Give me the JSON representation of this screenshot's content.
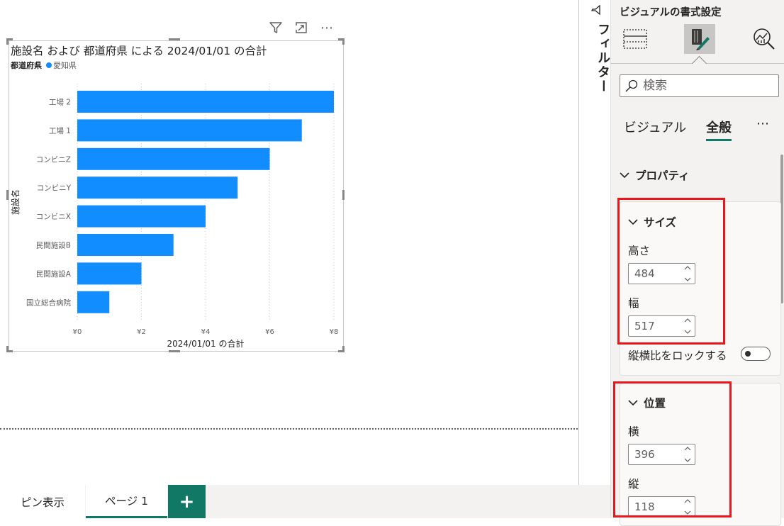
{
  "chart_data": {
    "type": "bar",
    "orientation": "horizontal",
    "title": "施設名 および 都道府県 による 2024/01/01 の合計",
    "legend_title": "都道府県",
    "series": [
      {
        "name": "愛知県",
        "color": "#118dff",
        "values": [
          8,
          7,
          6,
          5,
          4,
          3,
          2,
          1
        ]
      }
    ],
    "categories": [
      "工場 2",
      "工場 1",
      "コンビニZ",
      "コンビニY",
      "コンビニX",
      "民間施設B",
      "民間施設A",
      "国立総合病院"
    ],
    "x_ticks": [
      "¥0",
      "¥2",
      "¥4",
      "¥6",
      "¥8"
    ],
    "xlim": [
      0,
      8
    ],
    "xlabel": "2024/01/01 の合計",
    "ylabel": "施設名",
    "grid": true,
    "legend_position": "top-left"
  },
  "visual_header": {
    "icons": [
      "filter-icon",
      "focus-mode-icon",
      "more-options-icon"
    ],
    "more_label": "⋯"
  },
  "filter_pane": {
    "label": "フィルター"
  },
  "format_pane": {
    "title": "ビジュアルの書式設定",
    "tabs": [
      "build-visual-icon",
      "format-visual-icon",
      "analytics-icon"
    ],
    "search_placeholder": "検索",
    "subtabs": [
      "ビジュアル",
      "全般"
    ],
    "active_subtab": "全般",
    "more_label": "⋯",
    "section_properties": "プロパティ",
    "size": {
      "title": "サイズ",
      "height_label": "高さ",
      "height_value": "484",
      "width_label": "幅",
      "width_value": "517",
      "lock_label": "縦横比をロックする",
      "lock_on": false
    },
    "position": {
      "title": "位置",
      "horizontal_label": "横",
      "horizontal_value": "396",
      "vertical_label": "縦",
      "vertical_value": "118"
    },
    "highlight_color": "#e8171c",
    "accent_color": "#117865"
  },
  "page_tabs": {
    "pin_label": "ピン表示",
    "pages": [
      "ページ 1"
    ],
    "add_label": "+"
  }
}
